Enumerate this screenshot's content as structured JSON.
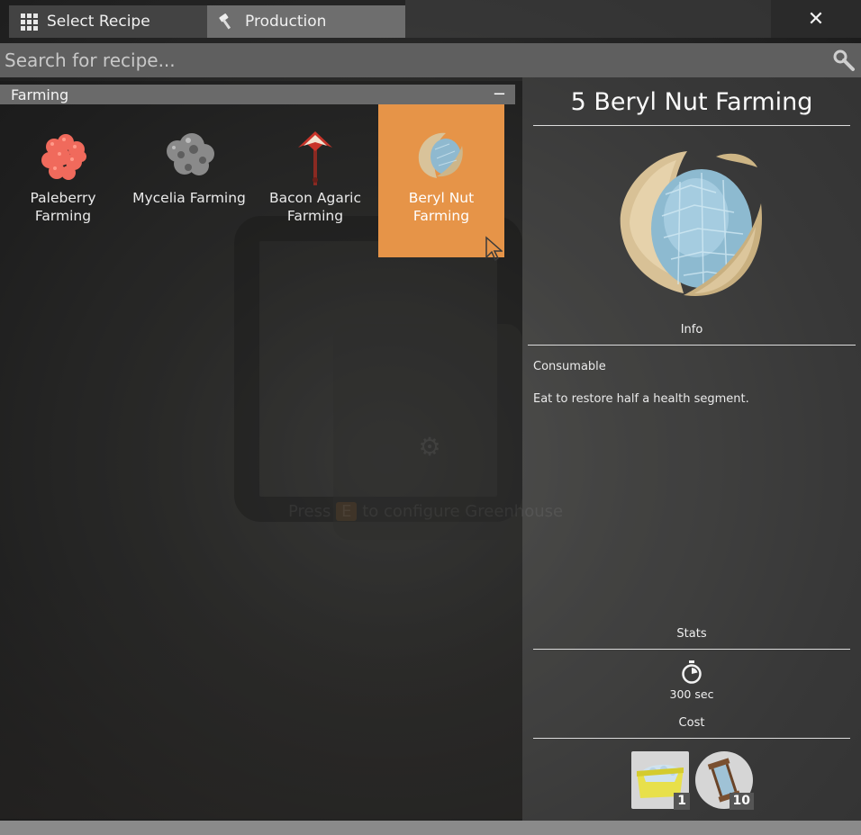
{
  "tabs": [
    {
      "label": "Select Recipe",
      "icon": "grid-icon"
    },
    {
      "label": "Production",
      "icon": "hammer-icon"
    }
  ],
  "close_label": "✕",
  "search": {
    "placeholder": "Search for recipe..."
  },
  "category": {
    "name": "Farming",
    "collapse_label": "−"
  },
  "recipes": [
    {
      "label": "Paleberry Farming",
      "icon": "paleberry-icon"
    },
    {
      "label": "Mycelia Farming",
      "icon": "mycelia-icon"
    },
    {
      "label": "Bacon Agaric Farming",
      "icon": "bacon-agaric-icon"
    },
    {
      "label": "Beryl Nut Farming",
      "icon": "beryl-nut-icon",
      "selected": true
    }
  ],
  "detail": {
    "title": "5  Beryl Nut Farming",
    "info_label": "Info",
    "type": "Consumable",
    "description": "Eat to restore half a health segment.",
    "stats_label": "Stats",
    "time": "300 sec",
    "cost_label": "Cost",
    "cost": [
      {
        "icon": "compost-box-icon",
        "qty": "1"
      },
      {
        "icon": "water-canister-icon",
        "qty": "10"
      }
    ]
  },
  "background_hint": {
    "prefix": "Press",
    "key": "E",
    "suffix": "to configure Greenhouse"
  },
  "colors": {
    "accent": "#e69448",
    "tab_active": "#434343",
    "tab_inactive": "#6e6e6e"
  }
}
